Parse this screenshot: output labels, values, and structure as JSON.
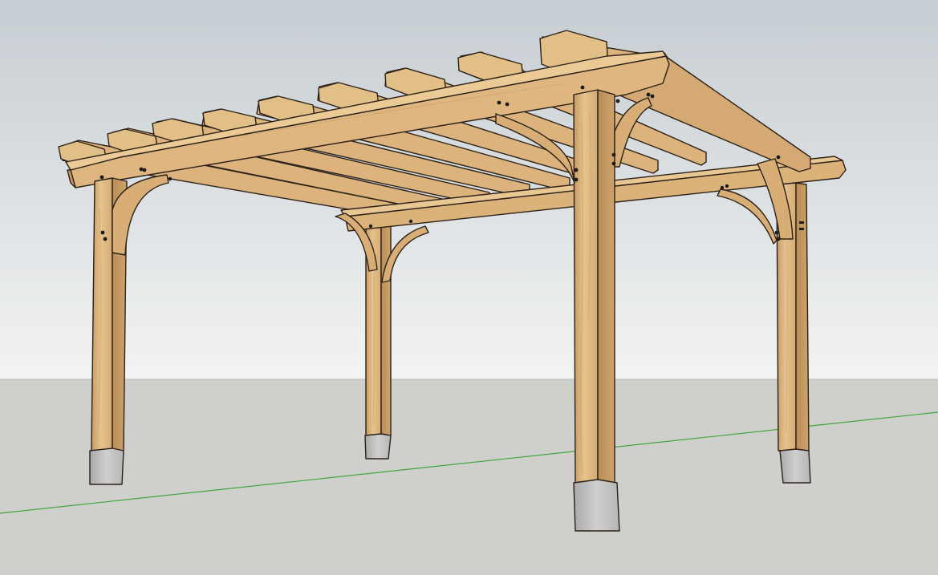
{
  "scene": {
    "subject": "pergola-3d-model",
    "colors": {
      "sky_top": "#c6cdd2",
      "sky_bottom": "#f2f3f3",
      "ground": "#cfd0cc",
      "horizon_line": "#b9bbb8",
      "axis_green": "#3fa53a",
      "wood_light": "#e6c38e",
      "wood_mid": "#d9b07a",
      "wood_dark": "#c09562",
      "wood_shadow": "#8c6a40",
      "edge": "#2b2118",
      "concrete_light": "#c9c9c9",
      "concrete_dark": "#9e9e9e",
      "bolt": "#1c1c1c"
    }
  }
}
